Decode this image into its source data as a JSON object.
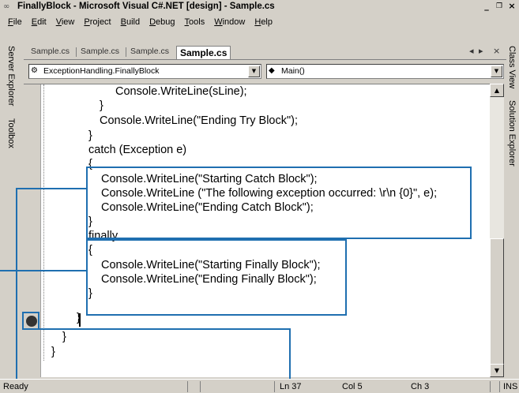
{
  "window": {
    "title": "FinallyBlock - Microsoft Visual C#.NET [design] - Sample.cs",
    "icon": "vs-app-icon",
    "buttons": [
      "_",
      "×"
    ]
  },
  "menu": [
    "File",
    "Edit",
    "View",
    "Project",
    "Build",
    "Debug",
    "Tools",
    "Window",
    "Help"
  ],
  "left_panels": [
    "Server Explorer",
    "Toolbox"
  ],
  "right_panels": [
    "Class View",
    "Solution Explorer"
  ],
  "doc_tabs": [
    "Sample.cs",
    "Sample.cs",
    "Sample.cs",
    "Sample.cs"
  ],
  "active_tab_index": 3,
  "nav": {
    "prev": "◂",
    "next": "▸",
    "close": "×"
  },
  "type_combo": "ExceptionHandling.FinallyBlock",
  "member_combo": "Main()",
  "code_lines": [
    "Console.WriteLine(sLine);",
    "}",
    "Console.WriteLine(\"Ending Try Block\");",
    "}",
    "catch (Exception e)",
    "{",
    "Console.WriteLine(\"Starting Catch Block\");",
    "Console.WriteLine (\"The following exception occurred:  \\r\\n {0}\", e);",
    "Console.WriteLine(\"Ending Catch Block\");",
    "}",
    "finally",
    "{",
    "Console.WriteLine(\"Starting Finally Block\");",
    "Console.WriteLine(\"Ending Finally Block\");",
    "}",
    "}",
    "}",
    "}"
  ],
  "status": {
    "message": "Ready",
    "line": "Ln 37",
    "col": "Col 5",
    "ch": "Ch 3",
    "mode": "INS"
  }
}
